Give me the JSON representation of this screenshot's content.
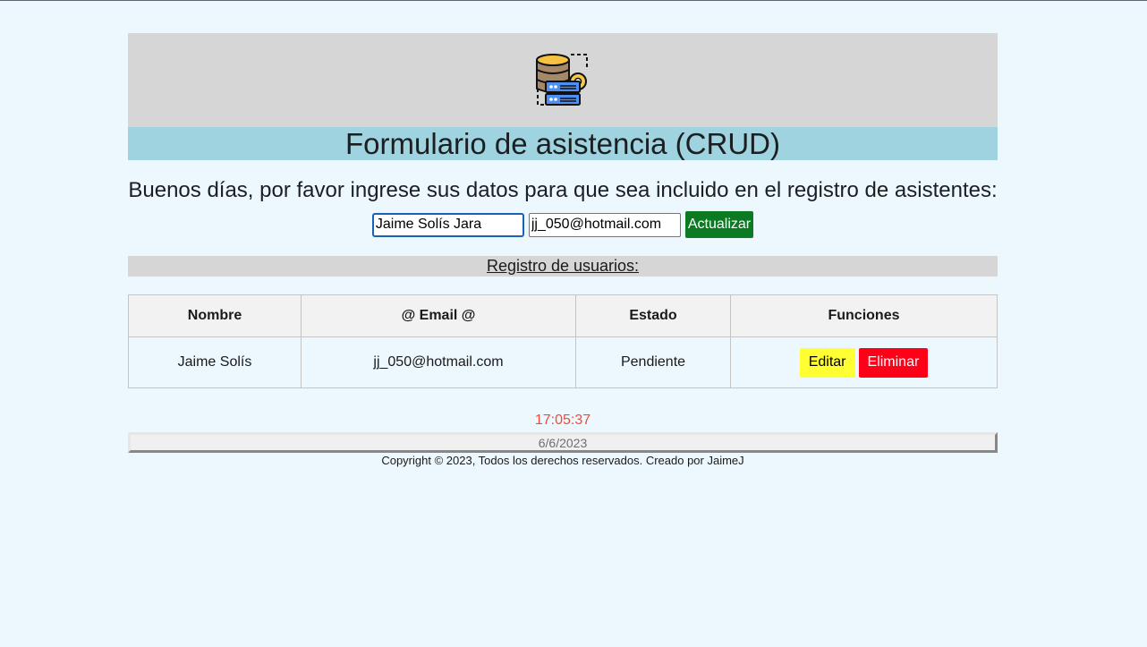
{
  "header": {
    "logo_icon": "database-server-gear-icon",
    "title": "Formulario de asistencia (CRUD)"
  },
  "greeting": "Buenos días, por favor ingrese sus datos para que sea incluido en el registro de asistentes:",
  "form": {
    "name_value": "Jaime Solís Jara",
    "email_value": "jj_050@hotmail.com",
    "submit_label": "Actualizar"
  },
  "registry": {
    "title": "Registro de usuarios:",
    "columns": [
      "Nombre",
      "@ Email @",
      "Estado",
      "Funciones"
    ],
    "rows": [
      {
        "nombre": "Jaime Solís",
        "email": "jj_050@hotmail.com",
        "estado": "Pendiente",
        "edit_label": "Editar",
        "delete_label": "Eliminar"
      }
    ]
  },
  "footer": {
    "time": "17:05:37",
    "date": "6/6/2023",
    "copyright": "Copyright © 2023, Todos los derechos reservados. Creado por JaimeJ"
  },
  "colors": {
    "page_bg": "#ecf8fe",
    "title_band": "#9fd3e0",
    "update_button": "#0b7a22",
    "edit_button": "#ffff33",
    "delete_button": "#ff0019",
    "clock_text": "#f04a3a"
  }
}
